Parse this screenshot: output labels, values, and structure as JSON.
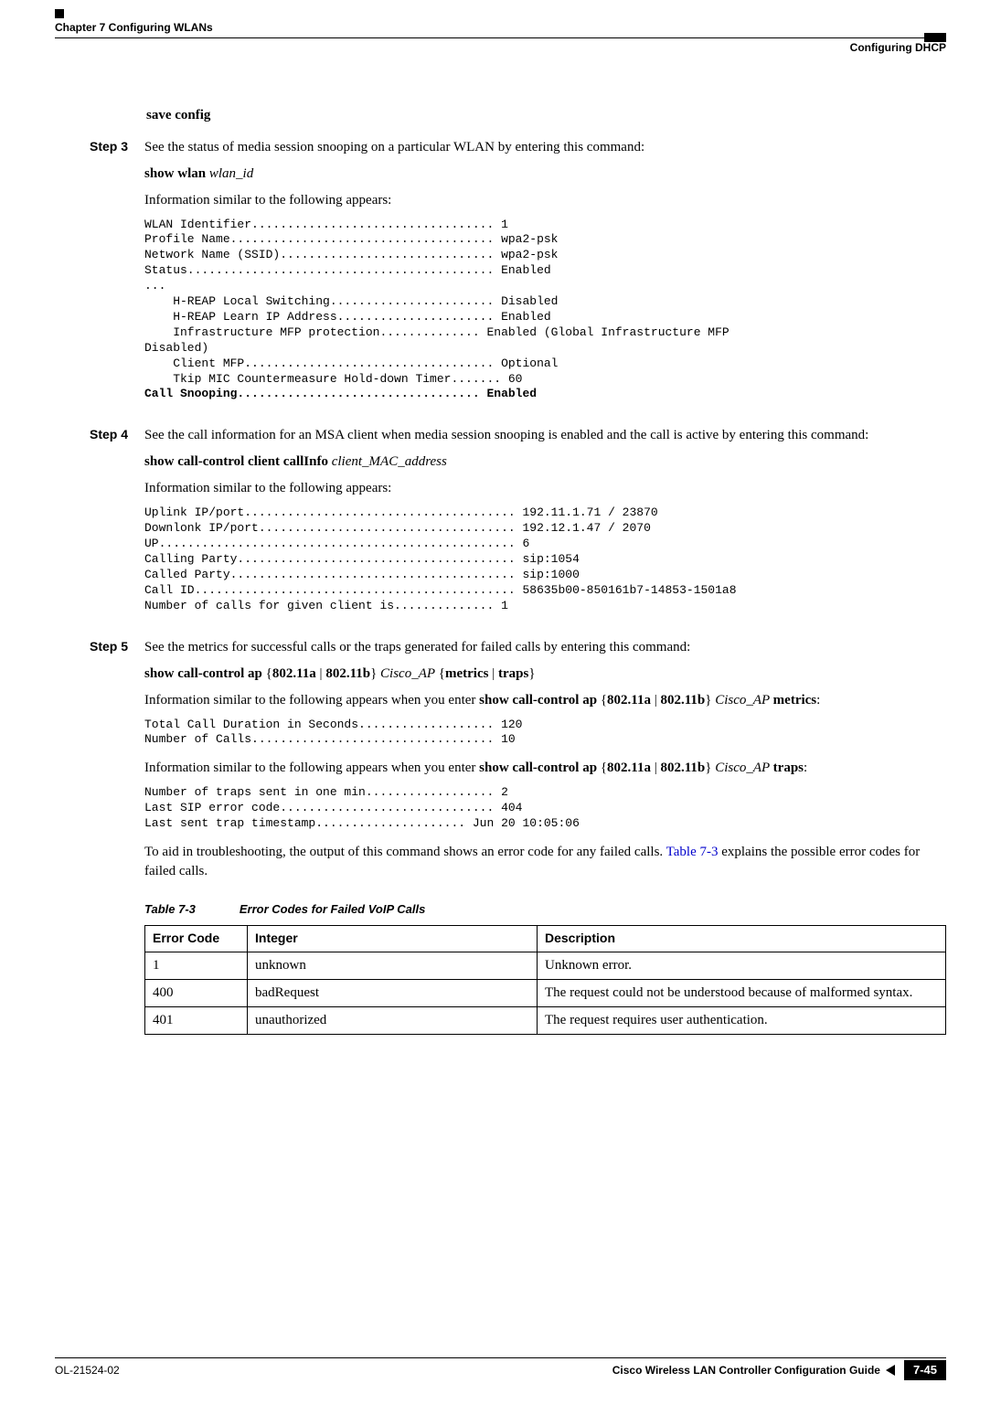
{
  "header": {
    "left": "Chapter 7      Configuring WLANs",
    "right_sub": "Configuring DHCP"
  },
  "body": {
    "save_config": "save config",
    "step3": {
      "label": "Step 3",
      "line1": "See the status of media session snooping on a particular WLAN by entering this command:",
      "cmd_bold": "show wlan",
      "cmd_italic": " wlan_id",
      "info_line": "Information similar to the following appears:",
      "pre": "WLAN Identifier.................................. 1\nProfile Name..................................... wpa2-psk\nNetwork Name (SSID).............................. wpa2-psk\nStatus........................................... Enabled\n...\n    H-REAP Local Switching....................... Disabled\n    H-REAP Learn IP Address...................... Enabled\n    Infrastructure MFP protection.............. Enabled (Global Infrastructure MFP\nDisabled)\n    Client MFP................................... Optional\n    Tkip MIC Countermeasure Hold-down Timer....... 60\n",
      "pre_bold": "Call Snooping.................................. Enabled"
    },
    "step4": {
      "label": "Step 4",
      "line1": "See the call information for an MSA client when media session snooping is enabled and the call is active by entering this command:",
      "cmd_bold": "show call-control client callInfo",
      "cmd_italic": " client_MAC_address",
      "info_line": "Information similar to the following appears:",
      "pre": "Uplink IP/port...................................... 192.11.1.71 / 23870\nDownlonk IP/port.................................... 192.12.1.47 / 2070\nUP.................................................. 6\nCalling Party....................................... sip:1054\nCalled Party........................................ sip:1000\nCall ID............................................. 58635b00-850161b7-14853-1501a8\nNumber of calls for given client is.............. 1"
    },
    "step5": {
      "label": "Step 5",
      "line1": "See the metrics for successful calls or the traps generated for failed calls by entering this command:",
      "cmd1_a": "show call-control ap",
      "cmd1_b": " {",
      "cmd1_c": "802.11a",
      "cmd1_d": " | ",
      "cmd1_e": "802.11b",
      "cmd1_f": "} ",
      "cmd1_g": "Cisco_AP",
      "cmd1_h": " {",
      "cmd1_i": "metrics",
      "cmd1_j": " | ",
      "cmd1_k": "traps",
      "cmd1_l": "}",
      "info2_pre": "Information similar to the following appears when you enter ",
      "info2_cmd": "show call-control ap",
      "info2_brace1": " {",
      "info2_a": "802.11a",
      "info2_pipe": " | ",
      "info2_b": "802.11b",
      "info2_brace2": "} ",
      "info2_ap": "Cisco_AP ",
      "info2_metrics": "metrics",
      "info2_colon": ":",
      "pre2": "Total Call Duration in Seconds................... 120\nNumber of Calls.................................. 10",
      "info3_pre": "Information similar to the following appears when you enter ",
      "info3_traps": "traps",
      "pre3": "Number of traps sent in one min.................. 2\nLast SIP error code.............................. 404\nLast sent trap timestamp..................... Jun 20 10:05:06",
      "trouble_a": "To aid in troubleshooting, the output of this command shows an error code for any failed calls. ",
      "trouble_link": "Table 7-3",
      "trouble_b": " explains the possible error codes for failed calls."
    },
    "table": {
      "caption_label": "Table 7-3",
      "caption_title": "Error Codes for Failed VoIP Calls",
      "headers": {
        "c1": "Error Code",
        "c2": "Integer",
        "c3": "Description"
      },
      "rows": [
        {
          "code": "1",
          "integer": "unknown",
          "desc": "Unknown error."
        },
        {
          "code": "400",
          "integer": "badRequest",
          "desc": "The request could not be understood because of malformed syntax."
        },
        {
          "code": "401",
          "integer": "unauthorized",
          "desc": "The request requires user authentication."
        }
      ]
    }
  },
  "footer": {
    "doc_id": "OL-21524-02",
    "title": "Cisco Wireless LAN Controller Configuration Guide",
    "page": "7-45"
  }
}
